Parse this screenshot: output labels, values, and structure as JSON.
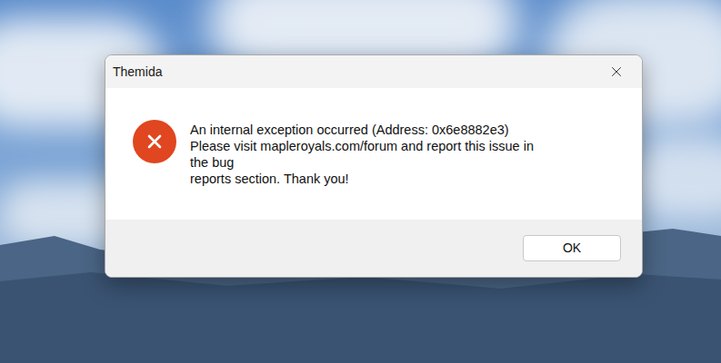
{
  "window": {
    "title": "Themida"
  },
  "message": {
    "kind": "error",
    "lines": [
      "An internal exception occurred (Address: 0x6e8882e3)",
      "Please visit mapleroyals.com/forum and report this issue in",
      "the bug",
      "reports section. Thank you!"
    ]
  },
  "buttons": [
    "OK"
  ]
}
